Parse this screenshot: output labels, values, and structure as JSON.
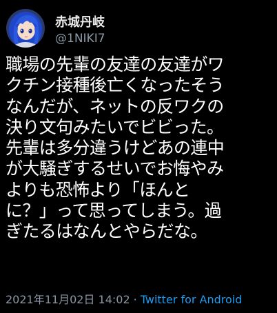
{
  "author": {
    "display_name": "赤城丹岐",
    "handle": "@1NIKI7"
  },
  "tweet": {
    "lines": [
      "職場の先輩の友達の友達がワ",
      "クチン接種後亡くなったそう",
      "なんだが、ネットの反ワクの",
      "決り文句みたいでビビった。",
      "先輩は多分違うけどあの連中",
      "が大騒ぎするせいでお悔やみ",
      "よりも恐怖より「ほんと",
      "に？」って思ってしまう。過",
      "ぎたるはなんとやらだな。"
    ]
  },
  "meta": {
    "timestamp": "2021年11月02日 14:02",
    "separator": "·",
    "source": "Twitter for Android"
  },
  "colors": {
    "background": "#000000",
    "text": "#ffffff",
    "secondary": "#8b98a5",
    "link": "#1d9bf0"
  }
}
